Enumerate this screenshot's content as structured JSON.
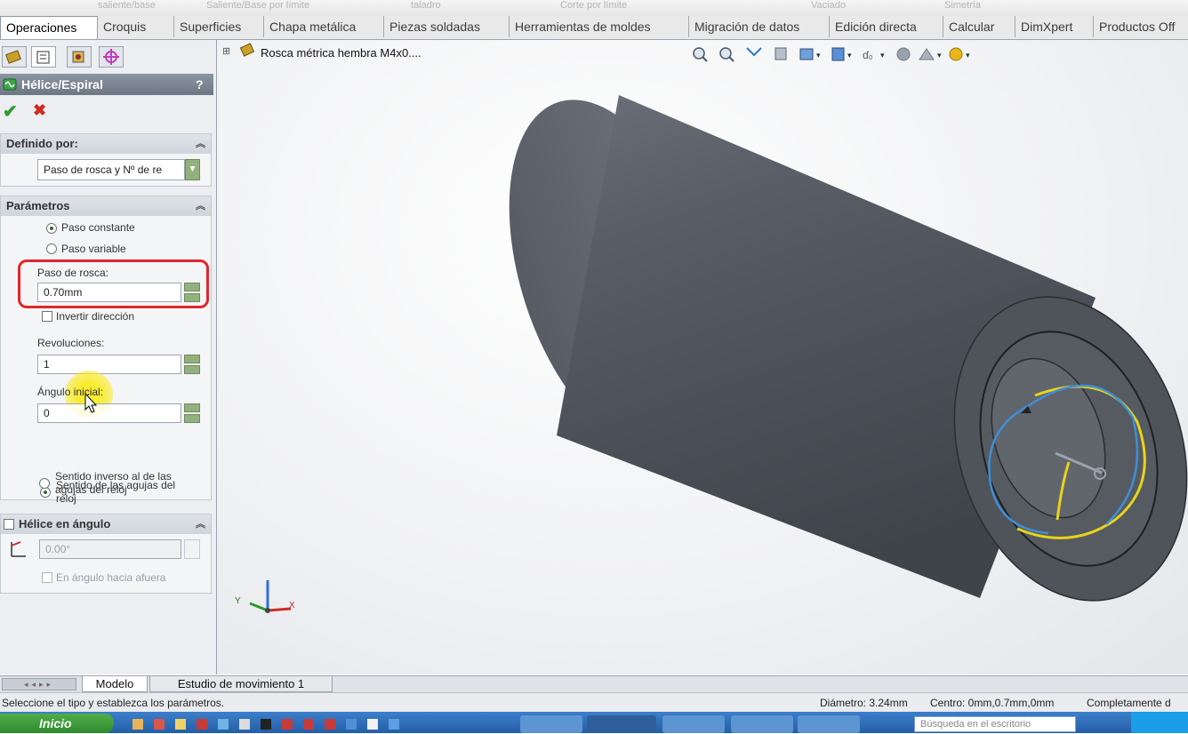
{
  "top_toolbar": {
    "items": [
      "saliente/base",
      "Saliente/Base por límite",
      "taladro",
      "Corte por límite",
      "Vaciado",
      "Simetría"
    ]
  },
  "tabs": [
    "Operaciones",
    "Croquis",
    "Superficies",
    "Chapa metálica",
    "Piezas soldadas",
    "Herramientas de moldes",
    "Migración de datos",
    "Edición directa",
    "Calcular",
    "DimXpert",
    "Productos Off"
  ],
  "feature": {
    "title": "Hélice/Espiral",
    "help": "?",
    "ok": "✔",
    "cancel": "✖"
  },
  "defined_by": {
    "header": "Definido por:",
    "value": "Paso de rosca y Nº de re"
  },
  "parameters": {
    "header": "Parámetros",
    "radio_constant": "Paso constante",
    "radio_variable": "Paso variable",
    "pitch_label": "Paso de rosca:",
    "pitch_value": "0.70mm",
    "reverse_label": "Invertir dirección",
    "revolutions_label": "Revoluciones:",
    "revolutions_value": "1",
    "angle_label": "Ángulo inicial:",
    "angle_value": "0",
    "cw_label_1": "Sentido de las agujas del",
    "cw_label_2": "reloj",
    "ccw_label_1": "Sentido inverso al de las",
    "ccw_label_2": "agujas del reloj"
  },
  "taper": {
    "header": "Hélice en ángulo",
    "value": "0.00°",
    "outward_label": "En ángulo hacia afuera"
  },
  "tree": {
    "expander": "⊞",
    "item": "Rosca métrica hembra M4x0...."
  },
  "triad": {
    "x": "X",
    "y": "Y"
  },
  "bottom_tabs": [
    "Modelo",
    "Estudio de movimiento 1"
  ],
  "status": {
    "message": "Seleccione el tipo y establezca los parámetros.",
    "diameter": "Diámetro: 3.24mm",
    "center": "Centro: 0mm,0.7mm,0mm",
    "state": "Completamente d"
  },
  "taskbar": {
    "start": "Inicio",
    "search": "Búsqueda en el escritorio"
  },
  "colors": {
    "highlight": "#e2262b",
    "helix_yellow": "#e8d31a",
    "helix_blue": "#3f8fd6"
  }
}
